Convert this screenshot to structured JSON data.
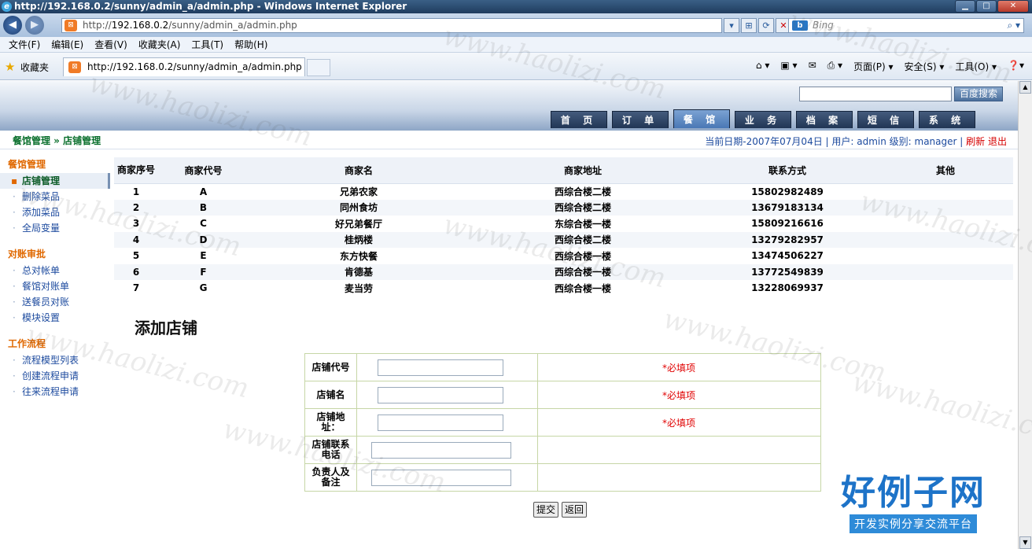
{
  "window": {
    "title": "http://192.168.0.2/sunny/admin_a/admin.php - Windows Internet Explorer",
    "address_prefix": "http://",
    "address_host": "192.168.0.2",
    "address_path": "/sunny/admin_a/admin.php",
    "search_placeholder": "Bing",
    "menu": [
      "文件(F)",
      "编辑(E)",
      "查看(V)",
      "收藏夹(A)",
      "工具(T)",
      "帮助(H)"
    ],
    "favorites_label": "收藏夹",
    "tab_title": "http://192.168.0.2/sunny/admin_a/admin.php",
    "commands": [
      "页面(P) ▾",
      "安全(S) ▾",
      "工具(O) ▾"
    ]
  },
  "header": {
    "search_button": "百度搜索",
    "tabs": [
      {
        "label": "首 页",
        "active": false
      },
      {
        "label": "订 单",
        "active": false
      },
      {
        "label": "餐 馆",
        "active": true
      },
      {
        "label": "业 务",
        "active": false
      },
      {
        "label": "档 案",
        "active": false
      },
      {
        "label": "短 信",
        "active": false
      },
      {
        "label": "系 统",
        "active": false
      }
    ]
  },
  "breadcrumb": "餐馆管理 » 店铺管理",
  "status": {
    "info": "当前日期-2007年07月04日 | 用户: admin  级别: manager  |",
    "refresh": "刷新",
    "logout": "退出"
  },
  "sidebar": {
    "groups": [
      {
        "title": "餐馆管理",
        "items": [
          {
            "label": "店铺管理",
            "active": true
          },
          {
            "label": "删除菜品",
            "active": false
          },
          {
            "label": "添加菜品",
            "active": false
          },
          {
            "label": "全局变量",
            "active": false
          }
        ]
      },
      {
        "title": "对账审批",
        "items": [
          {
            "label": "总对帐单",
            "active": false
          },
          {
            "label": "餐馆对账单",
            "active": false
          },
          {
            "label": "送餐员对账",
            "active": false
          },
          {
            "label": "模块设置",
            "active": false
          }
        ]
      },
      {
        "title": "工作流程",
        "items": [
          {
            "label": "流程模型列表",
            "active": false
          },
          {
            "label": "创建流程申请",
            "active": false
          },
          {
            "label": "往来流程申请",
            "active": false
          }
        ]
      }
    ]
  },
  "shops_table": {
    "headers": [
      "商家序号",
      "商家代号",
      "商家名",
      "商家地址",
      "联系方式",
      "其他"
    ],
    "rows": [
      [
        "1",
        "A",
        "兄弟农家",
        "西综合楼二楼",
        "15802982489",
        ""
      ],
      [
        "2",
        "B",
        "同州食坊",
        "西综合楼二楼",
        "13679183134",
        ""
      ],
      [
        "3",
        "C",
        "好兄弟餐厅",
        "东综合楼一楼",
        "15809216616",
        ""
      ],
      [
        "4",
        "D",
        "桂炳楼",
        "西综合楼二楼",
        "13279282957",
        ""
      ],
      [
        "5",
        "E",
        "东方快餐",
        "西综合楼一楼",
        "13474506227",
        ""
      ],
      [
        "6",
        "F",
        "肯德基",
        "西综合楼一楼",
        "13772549839",
        ""
      ],
      [
        "7",
        "G",
        "麦当劳",
        "西综合楼一楼",
        "13228069937",
        ""
      ]
    ]
  },
  "add_form": {
    "title": "添加店铺",
    "fields": [
      {
        "label": "店铺代号",
        "value": "",
        "note": "*必填项"
      },
      {
        "label": "店铺名",
        "value": "",
        "note": "*必填项"
      },
      {
        "label": "店铺地址：",
        "value": "",
        "note": "*必填项"
      },
      {
        "label": "店铺联系电话",
        "value": "",
        "note": ""
      },
      {
        "label": "负责人及备注",
        "value": "",
        "note": ""
      }
    ],
    "submit": "提交",
    "back": "返回"
  },
  "watermark": "www.haolizi.com",
  "brand": {
    "main": "好例子网",
    "sub": "开发实例分享交流平台"
  }
}
